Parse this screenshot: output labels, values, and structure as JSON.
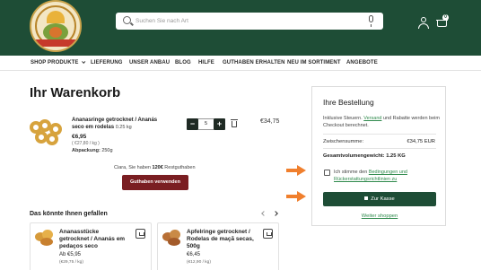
{
  "header": {
    "search_placeholder": "Suchen Sie nach Art",
    "cart_count": "0"
  },
  "nav": [
    {
      "label": "SHOP PRODUKTE"
    },
    {
      "label": "LIEFERUNG"
    },
    {
      "label": "UNSER ANBAU"
    },
    {
      "label": "BLOG"
    },
    {
      "label": "HILFE"
    },
    {
      "label": "GUTHABEN ERHALTEN"
    },
    {
      "label": "NEU IM SORTIMENT"
    },
    {
      "label": "ANGEBOTE"
    }
  ],
  "cart": {
    "title": "Ihr Warenkorb",
    "item": {
      "name": "Ananasringe getrocknet / Ananás seco em rodelas",
      "weight": "0.25 kg",
      "price": "€6,95",
      "unit_price": "( €27,80 / kg )",
      "pack_label": "Abpackung:",
      "pack_value": "250g",
      "quantity": "5",
      "total": "€34,75"
    },
    "credit_text_pre": "Ciara, Sie haben",
    "credit_amount": "120€",
    "credit_text_post": "Restguthaben",
    "credit_button": "Guthaben verwenden"
  },
  "recommendations": {
    "title": "Das könnte Ihnen gefallen",
    "cards": [
      {
        "name": "Ananasstücke getrocknet / Ananás em pedaços seco",
        "price": "Ab €5,95",
        "unit": "(€29,75 / kg)"
      },
      {
        "name": "Apfelringe getrocknet / Rodelas de maçã secas, 500g",
        "price": "€6,45",
        "unit": "(€12,90 / kg)"
      }
    ]
  },
  "order": {
    "title": "Ihre Bestellung",
    "note_pre": "Inklusive Steuern.",
    "note_link": "Versand",
    "note_post": "und Rabatte werden beim Checkout berechnet.",
    "subtotal_label": "Zwischensumme:",
    "subtotal_value": "€34,75 EUR",
    "weight_label": "Gesamtvolumengewicht: 1.25 KG",
    "terms_pre": "Ich stimme den",
    "terms_link": "Bedingungen und Rückerstattungsrichtlinien zu",
    "checkout_button": "Zur Kasse",
    "continue_link": "Weiter shoppen"
  },
  "colors": {
    "brand_green": "#1e4d36",
    "credit_button": "#7a1e22",
    "link_green": "#2f8a4c",
    "annotation_arrow": "#f07f2d"
  }
}
